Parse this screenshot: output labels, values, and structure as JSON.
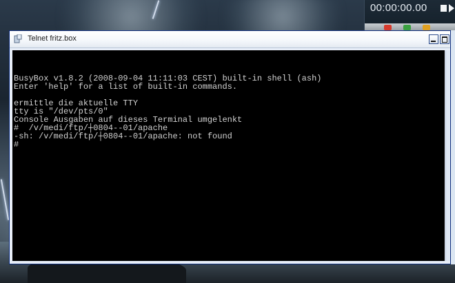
{
  "window": {
    "title": "Telnet fritz.box"
  },
  "player": {
    "time": "00:00:00.00"
  },
  "console": {
    "lines": [
      "",
      "BusyBox v1.8.2 (2008-09-04 11:11:03 CEST) built-in shell (ash)",
      "Enter 'help' for a list of built-in commands.",
      "",
      "ermittle die aktuelle TTY",
      "tty is \"/dev/pts/0\"",
      "Console Ausgaben auf dieses Terminal umgelenkt",
      "#  /v/medi/ftp/┼0804--01/apache",
      "-sh: /v/medi/ftp/┼0804--01/apache: not found",
      "#"
    ]
  },
  "icons": {
    "app": "telnet-app-icon",
    "minimize": "minimize-icon",
    "maximize": "maximize-icon",
    "stop": "stop-icon",
    "play": "play-icon"
  }
}
